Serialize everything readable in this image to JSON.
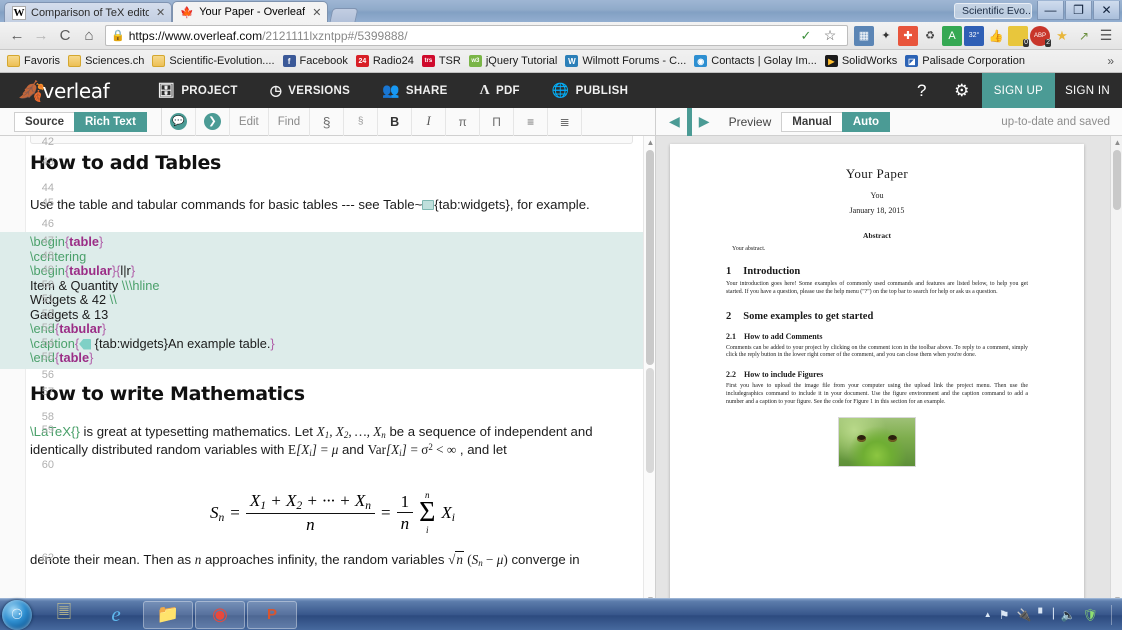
{
  "window": {
    "app_name": "Scientific Evo...",
    "minimize": "—",
    "maximize": "❐",
    "close": "✕"
  },
  "browser": {
    "tabs": [
      {
        "title": "Comparison of TeX editor",
        "favicon": "wikipedia-icon",
        "close": "✕",
        "active": false
      },
      {
        "title": "Your Paper - Overleaf",
        "favicon": "overleaf-icon",
        "close": "✕",
        "active": true
      }
    ],
    "nav": {
      "back": "←",
      "forward": "→",
      "reload": "C",
      "home": "⌂"
    },
    "omnibox": {
      "lock": "🔒",
      "host": "https://www.overleaf.com",
      "path": "/2121111lxzntpp#/5399888/",
      "bookmark_star": "☆",
      "translate": "✓"
    },
    "extensions": [
      {
        "name": "screenshot-extension",
        "glyph": "▤",
        "color": "#5b85b5"
      },
      {
        "name": "magic-wand-extension",
        "glyph": "✦",
        "color": "#4a4a4a"
      },
      {
        "name": "add-extension",
        "glyph": "✚",
        "color": "#e8553c"
      },
      {
        "name": "recycle-extension",
        "glyph": "♻",
        "color": "#3f3f3f"
      },
      {
        "name": "translate-extension",
        "glyph": "А",
        "color": "#35a853"
      },
      {
        "name": "weather-extension",
        "glyph": "32°",
        "color": "#2f5fb5"
      },
      {
        "name": "thumbs-up-extension",
        "glyph": "👍",
        "color": "#6b6b6b"
      },
      {
        "name": "notes-extension",
        "glyph": "▦",
        "color": "#e8c63c",
        "badge": "0"
      },
      {
        "name": "adblock-plus-extension",
        "glyph": "ABP",
        "color": "#c8352a",
        "badge": "2"
      },
      {
        "name": "star-extension",
        "glyph": "★",
        "color": "#e8b73c"
      },
      {
        "name": "pointer-extension",
        "glyph": "↗",
        "color": "#6b8f3f"
      }
    ],
    "menu_button": "☰",
    "bookmarks": [
      {
        "label": "Favoris",
        "icon": "folder-icon",
        "kind": "folder"
      },
      {
        "label": "Sciences.ch",
        "icon": "folder-icon",
        "kind": "folder"
      },
      {
        "label": "Scientific-Evolution....",
        "icon": "folder-icon",
        "kind": "folder"
      },
      {
        "label": "Facebook",
        "icon": "facebook-icon",
        "kind": "site",
        "color": "#3b5998",
        "glyph": "f"
      },
      {
        "label": "Radio24",
        "icon": "radio24-icon",
        "kind": "site",
        "color": "#d81f26",
        "glyph": "24"
      },
      {
        "label": "TSR",
        "icon": "tsr-icon",
        "kind": "site",
        "color": "#cf0a2c",
        "glyph": "trs"
      },
      {
        "label": "jQuery Tutorial",
        "icon": "jquery-icon",
        "kind": "site",
        "color": "#7ab547",
        "glyph": "w3"
      },
      {
        "label": "Wilmott Forums - C...",
        "icon": "wilmott-icon",
        "kind": "site",
        "color": "#2b7fb8",
        "glyph": "W"
      },
      {
        "label": "Contacts | Golay Im...",
        "icon": "contacts-icon",
        "kind": "site",
        "color": "#2d8fd1",
        "glyph": "◍"
      },
      {
        "label": "SolidWorks",
        "icon": "solidworks-icon",
        "kind": "site",
        "color": "#e8a93c",
        "glyph": "▶"
      },
      {
        "label": "Palisade Corporation",
        "icon": "palisade-icon",
        "kind": "site",
        "color": "#2c63b5",
        "glyph": "◪"
      }
    ],
    "overflow": "»"
  },
  "overleaf": {
    "logo": "verleaf",
    "logo_mark": "6",
    "nav": [
      {
        "label": "PROJECT",
        "icon": "folder-icon",
        "glyph": "▤"
      },
      {
        "label": "VERSIONS",
        "icon": "clock-icon",
        "glyph": "◷"
      },
      {
        "label": "SHARE",
        "icon": "people-icon",
        "glyph": "👥"
      },
      {
        "label": "PDF",
        "icon": "pdf-icon",
        "glyph": "⅄"
      },
      {
        "label": "PUBLISH",
        "icon": "globe-icon",
        "glyph": "◉"
      }
    ],
    "help_icon": "?",
    "settings_icon": "⚙",
    "sign_up": "SIGN UP",
    "sign_in": "SIGN IN",
    "accent_color": "#4b9b95"
  },
  "editor_toolbar": {
    "source_label": "Source",
    "rich_text_label": "Rich Text",
    "buttons": [
      {
        "name": "comment-button",
        "glyph": "💬",
        "label": ""
      },
      {
        "name": "forward-button",
        "glyph": "❯",
        "label": ""
      },
      {
        "name": "edit-button",
        "glyph": "",
        "label": "Edit"
      },
      {
        "name": "find-button",
        "glyph": "",
        "label": "Find"
      },
      {
        "name": "section-button",
        "glyph": "§",
        "label": ""
      },
      {
        "name": "subsection-button",
        "glyph": "§",
        "label": ""
      },
      {
        "name": "bold-button",
        "glyph": "B",
        "label": ""
      },
      {
        "name": "italic-button",
        "glyph": "I",
        "label": ""
      },
      {
        "name": "math-inline-button",
        "glyph": "π",
        "label": ""
      },
      {
        "name": "math-display-button",
        "glyph": "∏",
        "label": ""
      },
      {
        "name": "numbered-list-button",
        "glyph": "☰",
        "label": ""
      },
      {
        "name": "bullet-list-button",
        "glyph": "☷",
        "label": ""
      }
    ]
  },
  "preview_toolbar": {
    "collapse_left": "◀",
    "collapse_right": "▶",
    "preview_label": "Preview",
    "manual_label": "Manual",
    "auto_label": "Auto",
    "status": "up-to-date and saved"
  },
  "document": {
    "lines": [
      {
        "num": "42",
        "kind": "blank"
      },
      {
        "num": "43",
        "kind": "heading",
        "text": "How to add Tables"
      },
      {
        "num": "44",
        "kind": "blank"
      },
      {
        "num": "45",
        "kind": "para",
        "text": "Use the table and tabular commands for basic tables --- see Table~{tab:widgets}, for example."
      },
      {
        "num": "46",
        "kind": "blank"
      },
      {
        "num": "47",
        "kind": "code",
        "text": "\\begin{table}"
      },
      {
        "num": "48",
        "kind": "code",
        "text": "\\centering"
      },
      {
        "num": "49",
        "kind": "code",
        "text": "\\begin{tabular}{l|r}"
      },
      {
        "num": "50",
        "kind": "code",
        "text": "Item & Quantity \\\\\\hline"
      },
      {
        "num": "51",
        "kind": "code",
        "text": "Widgets & 42 \\\\"
      },
      {
        "num": "52",
        "kind": "code",
        "text": "Gadgets & 13"
      },
      {
        "num": "53",
        "kind": "code",
        "text": "\\end{tabular}"
      },
      {
        "num": "54",
        "kind": "code",
        "text": "\\caption{ {tab:widgets}An example table.}"
      },
      {
        "num": "55",
        "kind": "code",
        "text": "\\end{table}"
      },
      {
        "num": "56",
        "kind": "blank"
      },
      {
        "num": "57",
        "kind": "heading",
        "text": "How to write Mathematics"
      },
      {
        "num": "58",
        "kind": "blank"
      },
      {
        "num": "59",
        "kind": "para",
        "text": "\\LaTeX{} is great at typesetting mathematics. Let X1, X2, …, Xn be a sequence of independent and identically distributed random variables with E[Xi] = μ and Var[Xi] = σ² < ∞, and let"
      },
      {
        "num": "60",
        "kind": "blank"
      },
      {
        "num": "62",
        "kind": "para",
        "text": "denote their mean. Then as n approaches infinity, the random variables √n (Sn − μ) converge in"
      }
    ],
    "latex_command": "\\LaTeX{}",
    "para59": {
      "before": " is great at typesetting mathematics. Let ",
      "mid": " be a sequence of independent and identically distributed random variables with ",
      "and": " and ",
      "after": ", and let"
    },
    "para62": {
      "a": "denote their mean. Then as ",
      "b": " approaches infinity, the random variables ",
      "c": " converge in"
    },
    "equation": {
      "lhs": "S",
      "lhs_sub": "n",
      "eq": "=",
      "numerator": "X₁ + X₂ + ⋯ + Xₙ",
      "denominator": "n",
      "eq2": "=",
      "frac2_num": "1",
      "frac2_den": "n",
      "sum_upper": "n",
      "sum_lower": "i",
      "sum_body": "X",
      "sum_body_sub": "i"
    }
  },
  "pdf": {
    "title": "Your Paper",
    "author": "You",
    "date": "January 18, 2015",
    "abstract_heading": "Abstract",
    "abstract_text": "Your abstract.",
    "sections": [
      {
        "number": "1",
        "title": "Introduction",
        "body": "Your introduction goes here! Some examples of commonly used commands and features are listed below, to help you get started. If you have a question, please use the help menu (\"?\") on the top bar to search for help or ask us a question."
      },
      {
        "number": "2",
        "title": "Some examples to get started",
        "body": ""
      }
    ],
    "subsections": [
      {
        "number": "2.1",
        "title": "How to add Comments",
        "body": "Comments can be added to your project by clicking on the comment icon in the toolbar above. To reply to a comment, simply click the reply button in the lower right corner of the comment, and you can close them when you're done."
      },
      {
        "number": "2.2",
        "title": "How to include Figures",
        "body": "First you have to upload the image file from your computer using the upload link the project menu. Then use the includegraphics command to include it in your document. Use the figure environment and the caption command to add a number and a caption to your figure. See the code for Figure 1 in this section for an example."
      }
    ],
    "figure_alt": "frog-photo"
  },
  "taskbar": {
    "start": "⊞",
    "items": [
      {
        "name": "taskbar-sticky-notes",
        "glyph": "🗒",
        "pinned": false
      },
      {
        "name": "taskbar-internet-explorer",
        "glyph": "e",
        "pinned": false
      },
      {
        "name": "taskbar-file-explorer",
        "glyph": "🗂",
        "pinned": true
      },
      {
        "name": "taskbar-chrome",
        "glyph": "◉",
        "pinned": true
      },
      {
        "name": "taskbar-powerpoint",
        "glyph": "P",
        "pinned": true
      }
    ],
    "tray": [
      {
        "name": "tray-show-hidden-icons",
        "glyph": "▲"
      },
      {
        "name": "tray-action-center-flag",
        "glyph": "⚑"
      },
      {
        "name": "tray-power-icon",
        "glyph": "🔌"
      },
      {
        "name": "tray-network-icon",
        "glyph": "▁▃▅"
      },
      {
        "name": "tray-volume-icon",
        "glyph": "🔊"
      },
      {
        "name": "tray-antivirus-icon",
        "glyph": "🛡"
      }
    ]
  }
}
